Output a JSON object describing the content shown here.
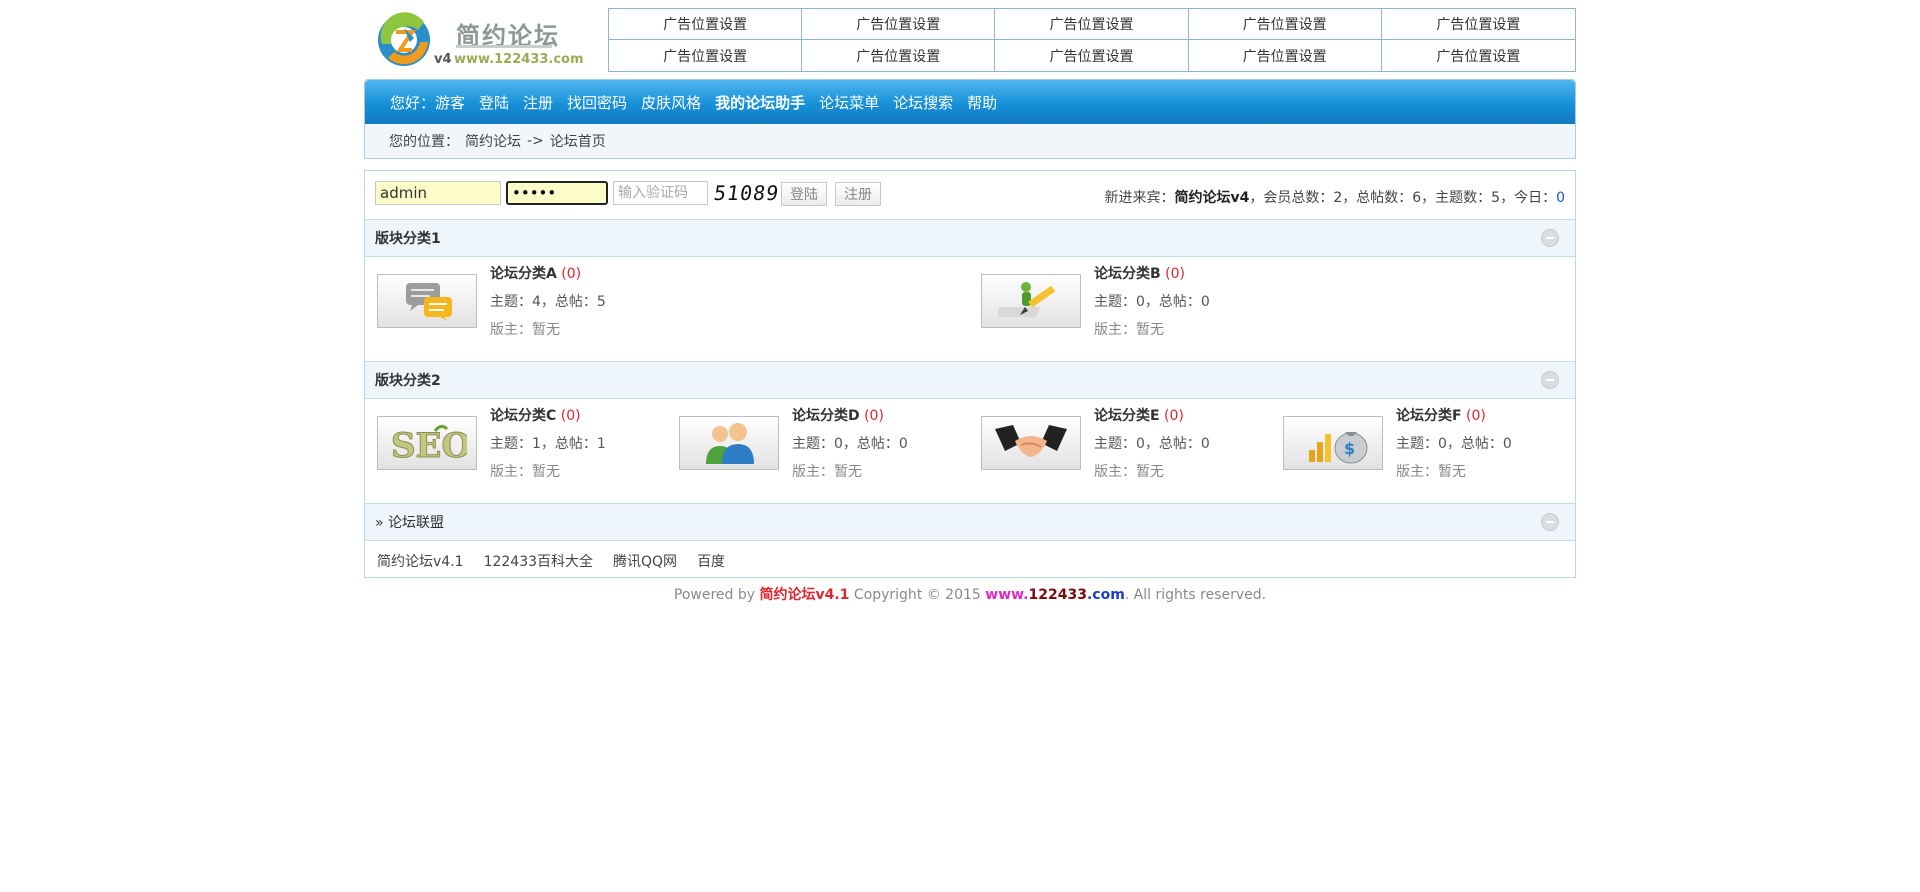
{
  "header": {
    "logo_text": "简约论坛",
    "logo_version": "v4",
    "logo_url": "www.122433.com",
    "ads": [
      "广告位置设置",
      "广告位置设置",
      "广告位置设置",
      "广告位置设置",
      "广告位置设置",
      "广告位置设置",
      "广告位置设置",
      "广告位置设置",
      "广告位置设置",
      "广告位置设置"
    ]
  },
  "nav": {
    "items": [
      "您好：游客",
      "登陆",
      "注册",
      "找回密码",
      "皮肤风格",
      "我的论坛助手",
      "论坛菜单",
      "论坛搜索",
      "帮助"
    ]
  },
  "breadcrumb": {
    "label": "您的位置：",
    "home": "简约论坛",
    "sep": "->",
    "current": "论坛首页"
  },
  "login": {
    "username": "admin",
    "password": "•••••",
    "code_placeholder": "输入验证码",
    "captcha": "51089",
    "login_label": "登陆",
    "register_label": "注册"
  },
  "stats": {
    "newest_label": "新进来宾：",
    "newest_name": "简约论坛v4",
    "members": "，会员总数：2，总帖数：6，主题数：5，今日：",
    "today": "0"
  },
  "sections": [
    {
      "title": "版块分类1",
      "forums": [
        {
          "name": "论坛分类A",
          "count": "(0)",
          "meta": "主题：4，总帖：5",
          "mod": "版主：暂无",
          "icon": "chat-bubbles-icon"
        },
        {
          "name": "论坛分类B",
          "count": "(0)",
          "meta": "主题：0，总帖：0",
          "mod": "版主：暂无",
          "icon": "pencil-person-icon"
        }
      ]
    },
    {
      "title": "版块分类2",
      "forums": [
        {
          "name": "论坛分类C",
          "count": "(0)",
          "meta": "主题：1，总帖：1",
          "mod": "版主：暂无",
          "icon": "seo-icon"
        },
        {
          "name": "论坛分类D",
          "count": "(0)",
          "meta": "主题：0，总帖：0",
          "mod": "版主：暂无",
          "icon": "users-icon"
        },
        {
          "name": "论坛分类E",
          "count": "(0)",
          "meta": "主题：0，总帖：0",
          "mod": "版主：暂无",
          "icon": "handshake-icon"
        },
        {
          "name": "论坛分类F",
          "count": "(0)",
          "meta": "主题：0，总帖：0",
          "mod": "版主：暂无",
          "icon": "money-bag-icon"
        }
      ]
    }
  ],
  "alliance": {
    "title": "» 论坛联盟",
    "links": [
      "简约论坛v4.1",
      "122433百科大全",
      "腾讯QQ网",
      "百度"
    ]
  },
  "footer": {
    "powered": "Powered by ",
    "brand": "简约论坛v4.1",
    "copyright": " Copyright © 2015 ",
    "www": "www.",
    "num": "122433",
    "com": ".com",
    "rights": ". All rights reserved."
  }
}
